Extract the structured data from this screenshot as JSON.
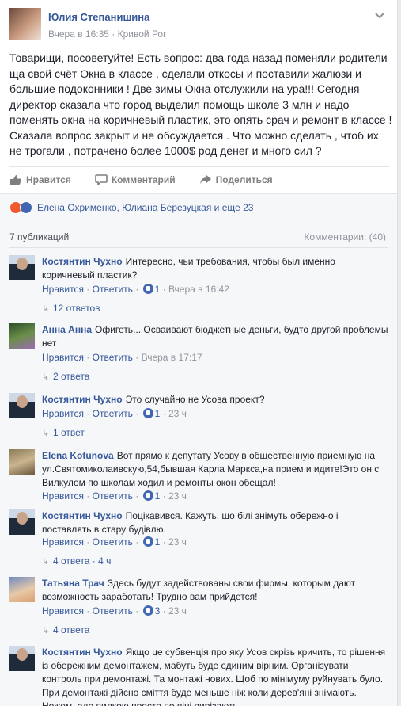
{
  "post": {
    "author": "Юлия Степанишина",
    "time": "Вчера в 16:35",
    "separator": "·",
    "location": "Кривой Рог",
    "text": "Товарищи, посоветуйте! Есть вопрос: два года назад поменяли родители ща свой счёт Окна в классе , сделали откосы и поставили жалюзи и большие подоконники ! Две зимы Окна отслужили на ура!!! Сегодня директор сказала что город выделил помощь школе 3 млн и надо поменять окна на коричневый пластик, это опять срач и ремонт в классе ! Сказала вопрос закрыт и не обсуждается . Что можно сделать , чтоб их не трогали , потрачено более 1000$ род денег и много сил ?",
    "actions": {
      "like": "Нравится",
      "comment": "Комментарий",
      "share": "Поделиться"
    },
    "reactions_text": "Елена Охрименко, Юлиана Березуцкая и еще 23",
    "publications": "7 публикаций",
    "comments_count": "Комментарии: (40)"
  },
  "comments": [
    {
      "name": "Костянтин Чухно",
      "text": "Интересно, чьи требования, чтобы был именно коричневый пластик?",
      "like": "Нравится",
      "reply": "Ответить",
      "likes": "1",
      "time": "Вчера в 16:42",
      "replies": "12 ответов"
    },
    {
      "name": "Анна Анна",
      "text": "Офигеть... Осваивают бюджетные деньги, будто другой проблемы нет",
      "like": "Нравится",
      "reply": "Ответить",
      "likes": "",
      "time": "Вчера в 17:17",
      "replies": "2 ответа"
    },
    {
      "name": "Костянтин Чухно",
      "text": "Это случайно не Усова проект?",
      "like": "Нравится",
      "reply": "Ответить",
      "likes": "1",
      "time": "23 ч",
      "replies": "1 ответ"
    },
    {
      "name": "Elena Kotunova",
      "text": "Вот прямо к депутату Усову в общественную приемную на ул.Святомиколаивскую,54,бывшая Карла Маркса,на прием и идите!Это он с Вилкулом по школам ходил и ремонты окон обещал!",
      "like": "Нравится",
      "reply": "Ответить",
      "likes": "1",
      "time": "23 ч",
      "replies": ""
    },
    {
      "name": "Костянтин Чухно",
      "text": "Поцікавився. Кажуть, що білі знімуть обережно і поставлять в стару будівлю.",
      "like": "Нравится",
      "reply": "Ответить",
      "likes": "1",
      "time": "23 ч",
      "replies": "4 ответа · 4 ч"
    },
    {
      "name": "Татьяна Трач",
      "text": "Здесь будут задействованы свои фирмы, которым дают возможность заработать! Трудно вам прийдется!",
      "like": "Нравится",
      "reply": "Ответить",
      "likes": "3",
      "time": "23 ч",
      "replies": "4 ответа"
    },
    {
      "name": "Костянтин Чухно",
      "text": "Якщо це субвенція про яку Усов скрізь кричить, то рішення із обережним демонтажем, мабуть буде єдиним вірним. Організувати контроль при демонтажі. Та монтажі нових. Щоб по мінімуму руйнувать було. При демонтажі дійсно сміття буде меньше ніж коли дерев'яні знімають. Ножем, адо пилкою просто по піні вирізають",
      "like": "",
      "reply": "",
      "likes": "",
      "time": "",
      "replies": ""
    }
  ],
  "icons": {
    "menu": "chevron-down-icon",
    "like": "thumbs-up-icon",
    "comment": "speech-bubble-icon",
    "share": "share-arrow-icon",
    "reply": "reply-arrow-icon"
  },
  "colors": {
    "link": "#365899",
    "muted": "#90949c",
    "like": "#4267b2",
    "angry": "#f0582e"
  }
}
